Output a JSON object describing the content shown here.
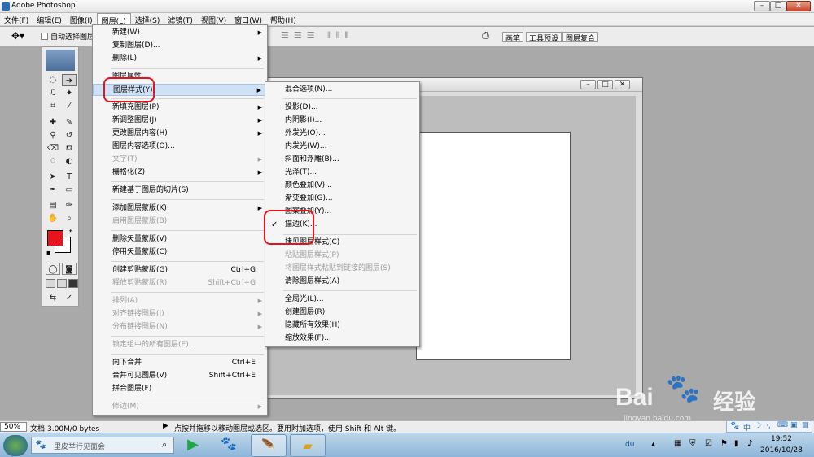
{
  "window": {
    "title": "Adobe Photoshop"
  },
  "menubar": {
    "items": [
      "文件(F)",
      "编辑(E)",
      "图像(I)",
      "图层(L)",
      "选择(S)",
      "滤镜(T)",
      "视图(V)",
      "窗口(W)",
      "帮助(H)"
    ]
  },
  "options": {
    "auto_select_label": "自动选择图层",
    "tabs": [
      "画笔",
      "工具预设",
      "图层复合"
    ]
  },
  "layer_menu": {
    "items": [
      {
        "label": "新建(W)",
        "arrow": "▶"
      },
      {
        "label": "复制图层(D)..."
      },
      {
        "label": "删除(L)",
        "arrow": "▶"
      },
      {
        "label": "图层属性..."
      },
      {
        "label": "图层样式(Y)",
        "arrow": "▶"
      },
      {
        "label": "新填充图层(P)",
        "arrow": "▶"
      },
      {
        "label": "新调整图层(J)",
        "arrow": "▶"
      },
      {
        "label": "更改图层内容(H)",
        "arrow": "▶"
      },
      {
        "label": "图层内容选项(O)..."
      },
      {
        "label": "文字(T)",
        "arrow": "▶"
      },
      {
        "label": "栅格化(Z)",
        "arrow": "▶"
      },
      {
        "label": "新建基于图层的切片(S)"
      },
      {
        "label": "添加图层蒙版(K)",
        "arrow": "▶"
      },
      {
        "label": "启用图层蒙版(B)"
      },
      {
        "label": "删除矢量蒙版(V)"
      },
      {
        "label": "停用矢量蒙版(C)"
      },
      {
        "label": "创建剪贴蒙版(G)",
        "shortcut": "Ctrl+G"
      },
      {
        "label": "释放剪贴蒙版(R)",
        "shortcut": "Shift+Ctrl+G"
      },
      {
        "label": "排列(A)",
        "arrow": "▶"
      },
      {
        "label": "对齐链接图层(I)",
        "arrow": "▶"
      },
      {
        "label": "分布链接图层(N)",
        "arrow": "▶"
      },
      {
        "label": "锁定组中的所有图层(E)..."
      },
      {
        "label": "向下合并",
        "shortcut": "Ctrl+E"
      },
      {
        "label": "合并可见图层(V)",
        "shortcut": "Shift+Ctrl+E"
      },
      {
        "label": "拼合图层(F)"
      },
      {
        "label": "修边(M)",
        "arrow": "▶"
      }
    ]
  },
  "style_menu": {
    "check": "✓",
    "items": [
      {
        "label": "混合选项(N)..."
      },
      {
        "label": "投影(D)..."
      },
      {
        "label": "内阴影(I)..."
      },
      {
        "label": "外发光(O)..."
      },
      {
        "label": "内发光(W)..."
      },
      {
        "label": "斜面和浮雕(B)..."
      },
      {
        "label": "光泽(T)..."
      },
      {
        "label": "颜色叠加(V)..."
      },
      {
        "label": "渐变叠加(G)..."
      },
      {
        "label": "图案叠加(Y)..."
      },
      {
        "label": "描边(K)..."
      },
      {
        "label": "拷贝图层样式(C)"
      },
      {
        "label": "粘贴图层样式(P)"
      },
      {
        "label": "将图层样式粘贴到链接的图层(S)"
      },
      {
        "label": "清除图层样式(A)"
      },
      {
        "label": "全局光(L)..."
      },
      {
        "label": "创建图层(R)"
      },
      {
        "label": "隐藏所有效果(H)"
      },
      {
        "label": "缩放效果(F)..."
      }
    ]
  },
  "status": {
    "zoom": "50%",
    "doc": "文档:3.00M/0 bytes",
    "hint": "点按并拖移以移动图层或选区。要用附加选项，使用 Shift 和 Alt 键。"
  },
  "taskbar": {
    "search_placeholder": "里皮举行见面会",
    "time": "19:52",
    "date": "2016/10/28",
    "ime": "中"
  },
  "watermark": {
    "brand": "Bai",
    "brand2": "经验",
    "url": "jingyan.baidu.com"
  },
  "colors": {
    "foreground": "#e8141c",
    "background": "#ffffff",
    "highlight_ring": "#e3121b"
  }
}
